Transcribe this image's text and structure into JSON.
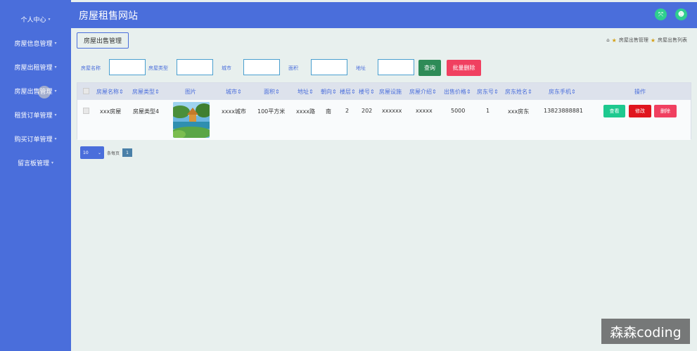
{
  "sidebar": {
    "items": [
      {
        "label": "个人中心"
      },
      {
        "label": "房屋信息管理"
      },
      {
        "label": "房屋出租管理"
      },
      {
        "label": "房屋出售管理"
      },
      {
        "label": "租赁订单管理"
      },
      {
        "label": "购买订单管理"
      },
      {
        "label": "留言板管理"
      }
    ]
  },
  "header": {
    "title": "房屋租售网站"
  },
  "page": {
    "tag_label": "房屋出售管理",
    "breadcrumb": [
      "房屋出售管理",
      "房屋出售列表"
    ]
  },
  "search": {
    "labels": [
      "房屋名称",
      "房屋类型",
      "城市",
      "面积",
      "地址"
    ],
    "values": [
      "",
      "",
      "",
      "",
      ""
    ],
    "query_label": "查询",
    "batch_delete_label": "批量删除"
  },
  "table": {
    "headers": [
      "房屋名称",
      "房屋类型",
      "图片",
      "城市",
      "面积",
      "地址",
      "朝向",
      "楼层",
      "楼号",
      "房屋设施",
      "房屋介绍",
      "出售价格",
      "房东号",
      "房东姓名",
      "房东手机",
      "操作"
    ],
    "rows": [
      {
        "name": "xxx房屋",
        "type": "房屋类型4",
        "city": "xxxx城市",
        "area": "100平方米",
        "address": "xxxx路",
        "orientation": "南",
        "floor": "2",
        "building": "202",
        "facilities": "xxxxxx",
        "intro": "xxxxx",
        "price": "5000",
        "landlord_no": "1",
        "landlord_name": "xxx房东",
        "landlord_phone": "13823888881",
        "actions": {
          "view": "查看",
          "edit": "修改",
          "delete": "删除"
        }
      }
    ]
  },
  "pager": {
    "page_size": "10",
    "per_page_label": "条每页",
    "current_page": "1"
  },
  "watermark": "森森coding",
  "colors": {
    "primary": "#4a6edb",
    "background": "#e8f0ee",
    "view": "#1ec98f",
    "edit": "#e0151e",
    "delete": "#f04060",
    "query": "#2e8b57"
  }
}
